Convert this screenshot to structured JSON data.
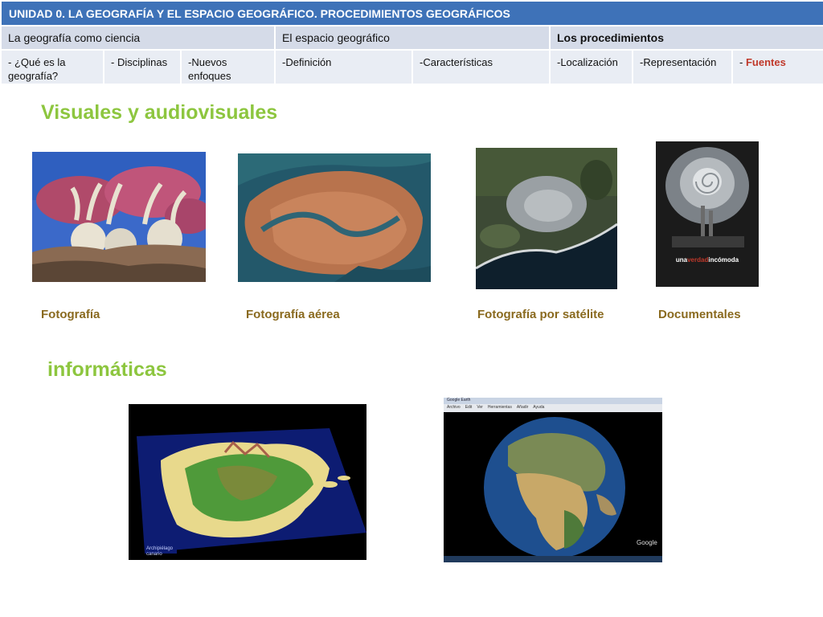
{
  "header": {
    "title": "UNIDAD 0.  LA GEOGRAFÍA Y EL ESPACIO GEOGRÁFICO. PROCEDIMIENTOS GEOGRÁFICOS"
  },
  "sections": [
    {
      "label": "La geografía como ciencia"
    },
    {
      "label": "El espacio geográfico"
    },
    {
      "label": "Los procedimientos",
      "active": true
    }
  ],
  "subsections": [
    {
      "label": "-  ¿Qué es la geografía?"
    },
    {
      "label": "- Disciplinas"
    },
    {
      "label": "-Nuevos enfoques"
    },
    {
      "label": "-Definición"
    },
    {
      "label": "-Características"
    },
    {
      "label": "-Localización"
    },
    {
      "label": "-Representación"
    },
    {
      "prefix": "- ",
      "label": "Fuentes",
      "active": true
    }
  ],
  "visual_section": {
    "heading": "Visuales y audiovisuales",
    "items": [
      {
        "caption": "Fotografía"
      },
      {
        "caption": "Fotografía aérea"
      },
      {
        "caption": "Fotografía por satélite"
      },
      {
        "caption": "Documentales"
      }
    ]
  },
  "poster": {
    "title_part1": "una",
    "title_part2": "verdad",
    "title_part3": "incómoda"
  },
  "digital_section": {
    "heading": "informáticas"
  },
  "map3d": {
    "label": "Archipiélago canario"
  },
  "earth": {
    "window_title": "Google Earth",
    "menu": [
      "Archivo",
      "Edit",
      "Ver",
      "Herramientas",
      "Añadir",
      "Ayuda"
    ],
    "logo": "Google"
  },
  "colors": {
    "title_bar": "#3e72b8",
    "section_bg": "#d5dbe8",
    "subsection_bg": "#e9edf4",
    "active": "#c0392b",
    "heading_green": "#8dc63f",
    "caption_brown": "#8a6a1f"
  }
}
